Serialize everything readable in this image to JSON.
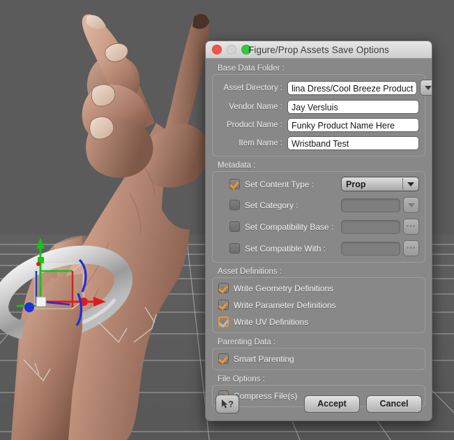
{
  "window": {
    "title": "Figure/Prop Assets Save Options",
    "traffic_lights": [
      "close-button",
      "minimize-button",
      "zoom-button"
    ],
    "colors": {
      "close": "#f0554b",
      "minimize": "#d4d4d4",
      "zoom": "#2ecc3f",
      "accent_check": "#F79421",
      "dialog_bg": "#888888",
      "titlebar_bg": "#dcdcdc"
    }
  },
  "sections": {
    "base_data_folder": {
      "label": "Base Data Folder :",
      "fields": [
        {
          "label": "Asset Directory :",
          "value": "lina Dress/Cool Breeze Product",
          "type": "combo"
        },
        {
          "label": "Vendor Name :",
          "value": "Jay Versluis",
          "type": "text"
        },
        {
          "label": "Product Name :",
          "value": "Funky Product Name Here",
          "type": "text"
        },
        {
          "label": "Item Name :",
          "value": "Wristband Test",
          "type": "text"
        }
      ]
    },
    "metadata": {
      "label": "Metadata :",
      "rows": [
        {
          "label": "Set Content Type :",
          "checked": true,
          "control": "select",
          "value": "Prop",
          "enabled": true
        },
        {
          "label": "Set Category :",
          "checked": false,
          "control": "select",
          "value": "",
          "enabled": false
        },
        {
          "label": "Set Compatibility Base :",
          "checked": false,
          "control": "browse",
          "value": "",
          "enabled": false
        },
        {
          "label": "Set Compatible With :",
          "checked": false,
          "control": "browse",
          "value": "",
          "enabled": false
        }
      ]
    },
    "asset_definitions": {
      "label": "Asset Definitions :",
      "rows": [
        {
          "label": "Write Geometry Definitions",
          "checked": true,
          "focused": false
        },
        {
          "label": "Write Parameter Definitions",
          "checked": true,
          "focused": false
        },
        {
          "label": "Write UV Definitions",
          "checked": true,
          "focused": true
        }
      ]
    },
    "parenting_data": {
      "label": "Parenting Data :",
      "rows": [
        {
          "label": "Smart Parenting",
          "checked": true,
          "focused": false
        }
      ]
    },
    "file_options": {
      "label": "File Options :",
      "rows": [
        {
          "label": "Compress File(s)",
          "checked": true,
          "focused": false
        }
      ]
    }
  },
  "footer": {
    "help_label": "?",
    "help_icon": "cursor-question-icon",
    "accept_label": "Accept",
    "cancel_label": "Cancel"
  },
  "viewport": {
    "description": "3D viewport showing a rendered human hand and wrist with a gray torus wristband and a translate/rotate transform gizmo on a perspective floor grid",
    "gizmo_axis_colors": {
      "x": "#e01b1b",
      "y": "#15c415",
      "z": "#1b30e0"
    },
    "background_color": "#5b5b5b",
    "grid_color": "#bdbdbd"
  }
}
